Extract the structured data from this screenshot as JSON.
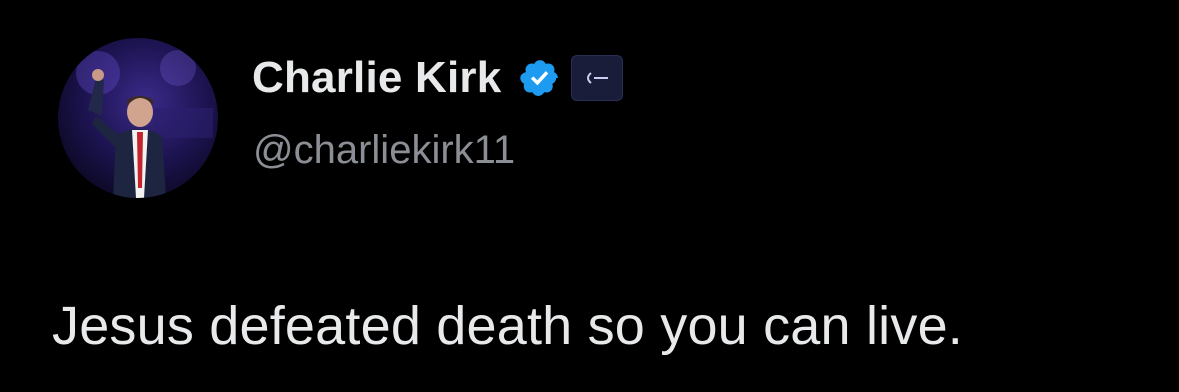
{
  "author": {
    "display_name": "Charlie Kirk",
    "handle": "@charliekirk11",
    "verified": true,
    "avatar_icon": "profile-photo-speaker-on-stage",
    "verified_icon": "blue-check-badge-icon",
    "affiliate_icon": "organization-affiliate-badge-icon"
  },
  "tweet": {
    "text": "Jesus defeated death so you can live."
  },
  "colors": {
    "background": "#000000",
    "primary_text": "#e7e9ea",
    "secondary_text": "#8b8f95",
    "verified_blue": "#1d9bf0"
  }
}
